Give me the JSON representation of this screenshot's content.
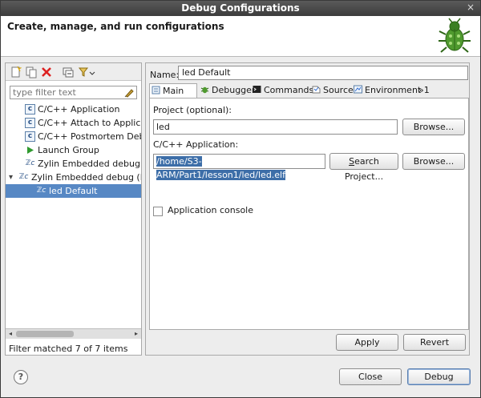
{
  "window": {
    "title": "Debug Configurations",
    "close_glyph": "×"
  },
  "banner": {
    "heading": "Create, manage, and run configurations",
    "icon": "bug-icon"
  },
  "left": {
    "toolbar": [
      "new-configuration-icon",
      "duplicate-icon",
      "delete-icon",
      "collapse-all-icon",
      "filter-menu-icon"
    ],
    "filter_placeholder": "type filter text",
    "tree": [
      {
        "label": "C/C++ Application",
        "icon": "c-icon",
        "indent": 1,
        "expander": "",
        "selected": false
      },
      {
        "label": "C/C++ Attach to Application",
        "icon": "c-icon",
        "indent": 1,
        "expander": "",
        "selected": false
      },
      {
        "label": "C/C++ Postmortem Debugger",
        "icon": "c-icon",
        "indent": 1,
        "expander": "",
        "selected": false
      },
      {
        "label": "Launch Group",
        "icon": "launch-group-icon",
        "indent": 1,
        "expander": "",
        "selected": false
      },
      {
        "label": "Zylin Embedded debug (Cygwin)",
        "icon": "zylin-icon",
        "indent": 1,
        "expander": "",
        "selected": false
      },
      {
        "label": "Zylin Embedded debug (Native)",
        "icon": "zylin-icon",
        "indent": 0,
        "expander": "▾",
        "selected": false
      },
      {
        "label": "led Default",
        "icon": "zylin-icon",
        "indent": 2,
        "expander": "",
        "selected": true
      }
    ],
    "filter_status": "Filter matched 7 of 7 items"
  },
  "right": {
    "name_label": "Name:",
    "name_value": "led Default",
    "tabs": [
      {
        "label": "Main",
        "icon": "main-tab-icon",
        "active": true
      },
      {
        "label": "Debugger",
        "icon": "debugger-tab-icon",
        "active": false
      },
      {
        "label": "Commands",
        "icon": "commands-tab-icon",
        "active": false
      },
      {
        "label": "Source",
        "icon": "source-tab-icon",
        "active": false
      },
      {
        "label": "Environment",
        "icon": "environment-tab-icon",
        "active": false
      }
    ],
    "tab_overflow": "»1",
    "project_label": "Project (optional):",
    "project_value": "led",
    "browse_label": "Browse...",
    "app_label": "C/C++ Application:",
    "app_value": "/home/S3-ARM/Part1/lesson1/led/led.elf",
    "search_project_label": "Search Project...",
    "app_console_label": "Application console",
    "app_console_checked": false,
    "apply_label": "Apply",
    "revert_label": "Revert"
  },
  "footer": {
    "help_label": "?",
    "close_label": "Close",
    "debug_label": "Debug"
  },
  "colors": {
    "selection": "#5788c4",
    "highlight": "#3d6ea8"
  }
}
